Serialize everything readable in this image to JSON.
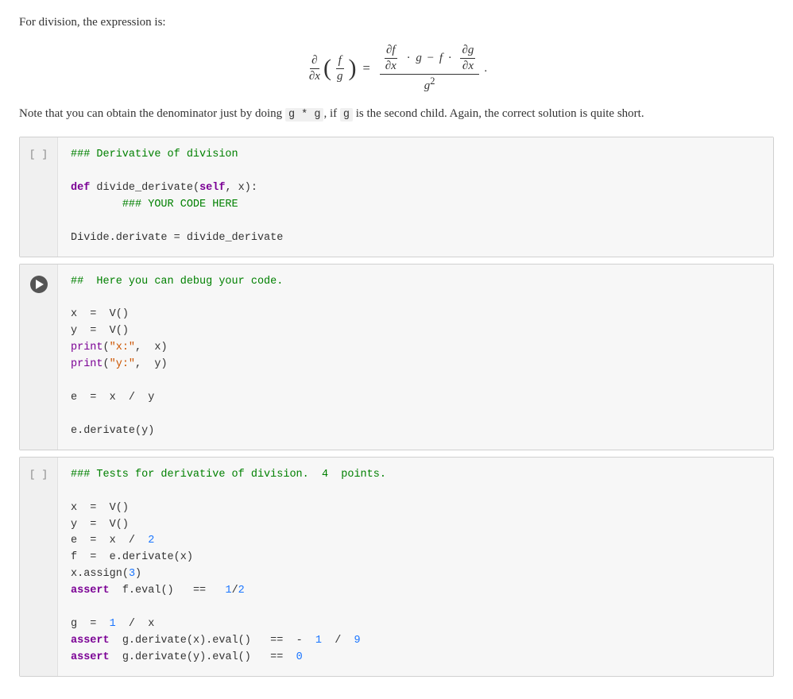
{
  "page": {
    "intro_text": "For division, the expression is:",
    "note_text": "Note that you can obtain the denominator just by doing ",
    "note_inline1": "g * g",
    "note_middle": ", if ",
    "note_inline2": "g",
    "note_end": " is the second child. Again, the correct solution is quite short.",
    "cells": [
      {
        "id": "cell-1",
        "gutter_label": "[ ]",
        "runnable": false,
        "code": "### Derivative of division\n\ndef divide_derivate(self, x):\n        ### YOUR CODE HERE\n\nDivide.derivate = divide_derivate"
      },
      {
        "id": "cell-2",
        "gutter_label": "",
        "runnable": true,
        "code": "##  Here you can debug your code.\n\nx = V()\ny = V()\nprint(\"x:\", x)\nprint(\"y:\", y)\n\ne = x / y\n\ne.derivate(y)"
      },
      {
        "id": "cell-3",
        "gutter_label": "[ ]",
        "runnable": false,
        "code": "### Tests for derivative of division. 4 points.\n\nx = V()\ny = V()\ne = x / 2\nf = e.derivate(x)\nx.assign(3)\nassert f.eval() == 1/2\n\ng = 1 / x\nassert g.derivate(x).eval() == - 1 / 9\nassert g.derivate(y).eval() == 0"
      }
    ]
  }
}
